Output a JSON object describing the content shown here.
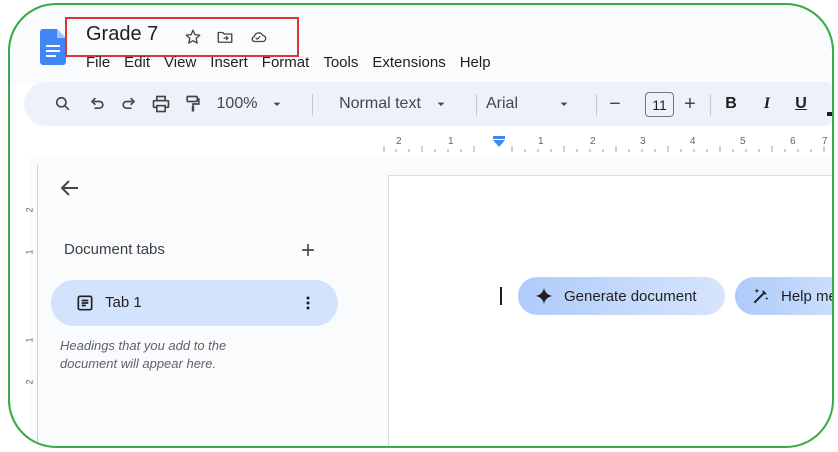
{
  "app": {
    "title": "Grade 7",
    "menu": [
      "File",
      "Edit",
      "View",
      "Insert",
      "Format",
      "Tools",
      "Extensions",
      "Help"
    ]
  },
  "toolbar": {
    "zoom": "100%",
    "style": "Normal text",
    "font": "Arial",
    "font_size": "11",
    "minus": "−",
    "plus": "+",
    "bold": "B",
    "italic": "I",
    "underline": "U"
  },
  "ruler": {
    "numbers": [
      "2",
      "1",
      "1",
      "2",
      "3",
      "4",
      "5",
      "6",
      "7"
    ]
  },
  "vertical_ruler": {
    "numbers": [
      "2",
      "1",
      "1",
      "2"
    ]
  },
  "sidebar": {
    "heading": "Document tabs",
    "tabs": [
      {
        "label": "Tab 1"
      }
    ],
    "hint": "Headings that you add to the document will appear here."
  },
  "editor": {
    "chips": {
      "generate": "Generate document",
      "help": "Help me"
    }
  },
  "colors": {
    "frame": "#3bab4a",
    "highlight": "#d93636",
    "tab_selected": "#d3e3fd",
    "accent": "#4285f4"
  }
}
